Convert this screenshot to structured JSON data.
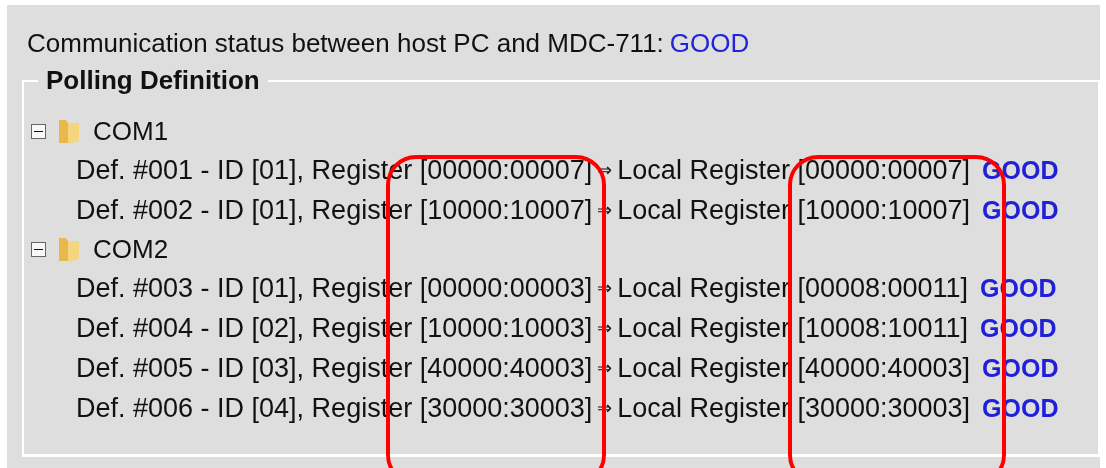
{
  "status_line": {
    "label": "Communication status between host PC and MDC-711:",
    "value": "GOOD"
  },
  "polling_definition": {
    "title": "Polling Definition",
    "ports": [
      {
        "name": "COM1",
        "expanded": true,
        "children": [
          {
            "source": "Def. #001 - ID [01], Register [00000:00007]",
            "arrow": "⇒",
            "target": "Local Register [00000:00007]",
            "status": "GOOD"
          },
          {
            "source": "Def. #002 - ID [01], Register [10000:10007]",
            "arrow": "⇒",
            "target": "Local Register [10000:10007]",
            "status": "GOOD"
          }
        ]
      },
      {
        "name": "COM2",
        "expanded": true,
        "children": [
          {
            "source": "Def. #003 - ID [01], Register [00000:00003]",
            "arrow": "⇒",
            "target": "Local Register [00008:00011]",
            "status": "GOOD"
          },
          {
            "source": "Def. #004 - ID [02], Register [10000:10003]",
            "arrow": "⇒",
            "target": "Local Register [10008:10011]",
            "status": "GOOD"
          },
          {
            "source": "Def. #005 - ID [03], Register [40000:40003]",
            "arrow": "⇒",
            "target": "Local Register [40000:40003]",
            "status": "GOOD"
          },
          {
            "source": "Def. #006 - ID [04], Register [30000:30003]",
            "arrow": "⇒",
            "target": "Local Register [30000:30003]",
            "status": "GOOD"
          }
        ]
      }
    ]
  },
  "annotations": [
    {
      "kind": "frame"
    },
    {
      "kind": "frame"
    }
  ]
}
